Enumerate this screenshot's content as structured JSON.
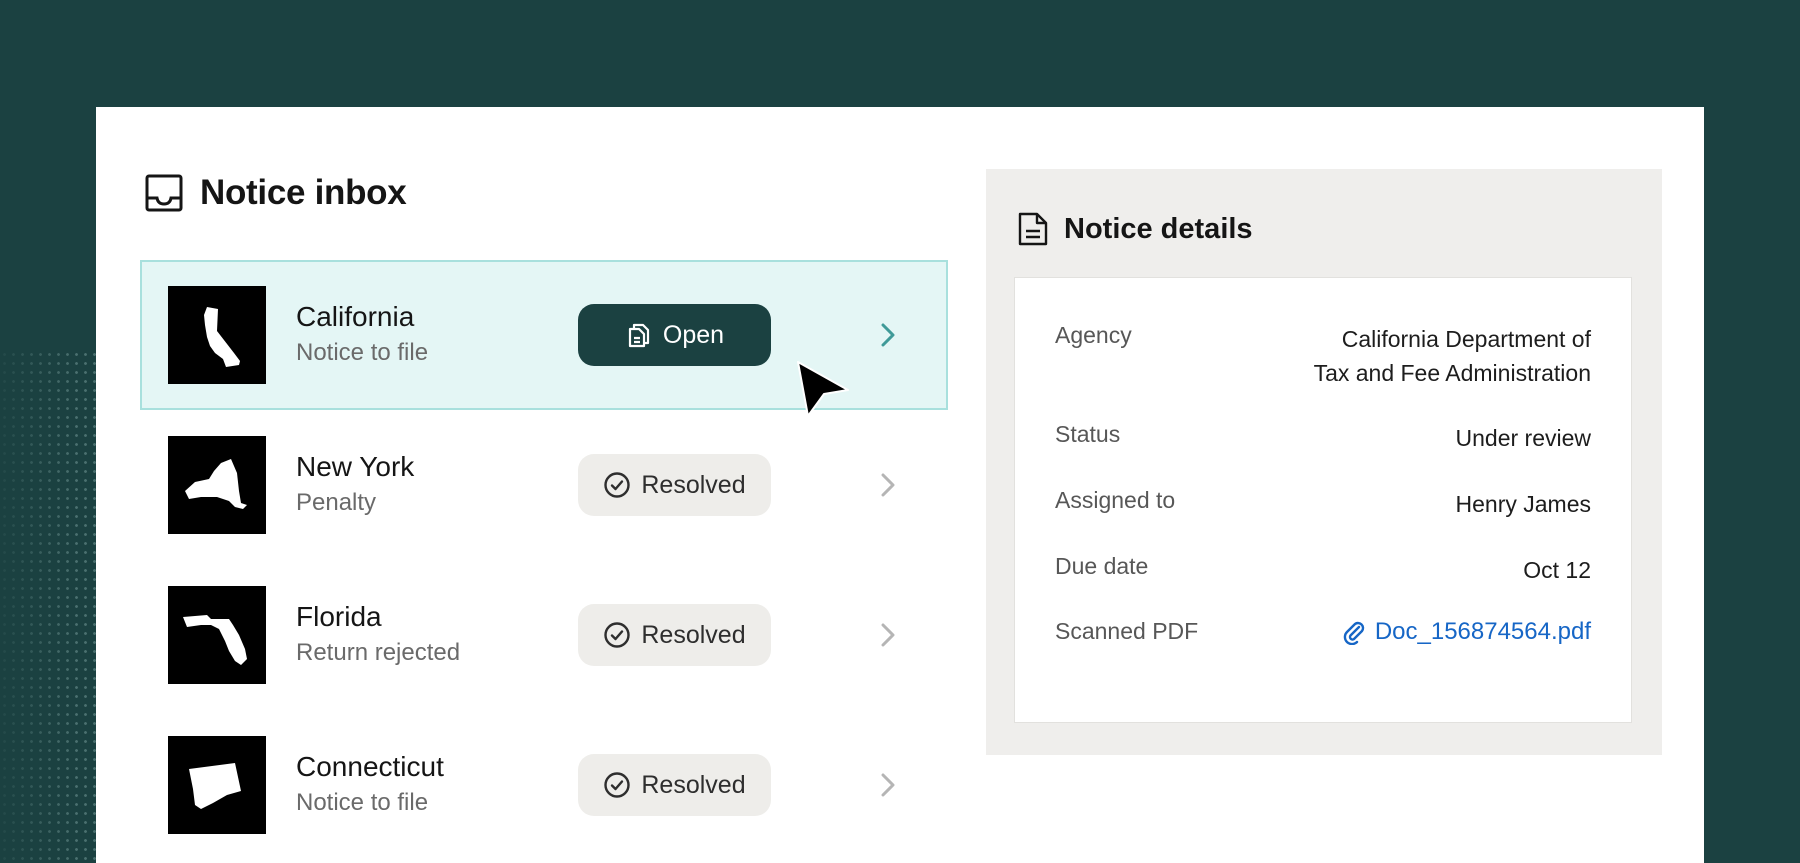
{
  "inbox": {
    "title": "Notice inbox",
    "items": [
      {
        "state": "California",
        "subtitle": "Notice to file",
        "status": "Open",
        "active": true
      },
      {
        "state": "New York",
        "subtitle": "Penalty",
        "status": "Resolved",
        "active": false
      },
      {
        "state": "Florida",
        "subtitle": "Return rejected",
        "status": "Resolved",
        "active": false
      },
      {
        "state": "Connecticut",
        "subtitle": "Notice to file",
        "status": "Resolved",
        "active": false
      }
    ]
  },
  "details": {
    "title": "Notice details",
    "agency_label": "Agency",
    "agency_line1": "California Department of",
    "agency_line2": "Tax and Fee Administration",
    "status_label": "Status",
    "status_value": "Under review",
    "assigned_label": "Assigned to",
    "assigned_value": "Henry James",
    "due_label": "Due date",
    "due_value": "Oct 12",
    "pdf_label": "Scanned PDF",
    "pdf_value": "Doc_156874564.pdf"
  },
  "colors": {
    "background": "#1b4141",
    "active_row": "#e4f6f5",
    "active_border": "#a8e0dd",
    "open_button": "#1b4141",
    "resolved_pill": "#eeedea",
    "link": "#1666c6",
    "panel": "#efeeec"
  },
  "icons": {
    "inbox": "inbox-tray-icon",
    "details": "document-icon",
    "open": "copy-documents-icon",
    "resolved": "check-circle-icon",
    "row": "chevron-right-icon",
    "attachment": "paperclip-icon",
    "pointer": "mouse-cursor-icon"
  }
}
